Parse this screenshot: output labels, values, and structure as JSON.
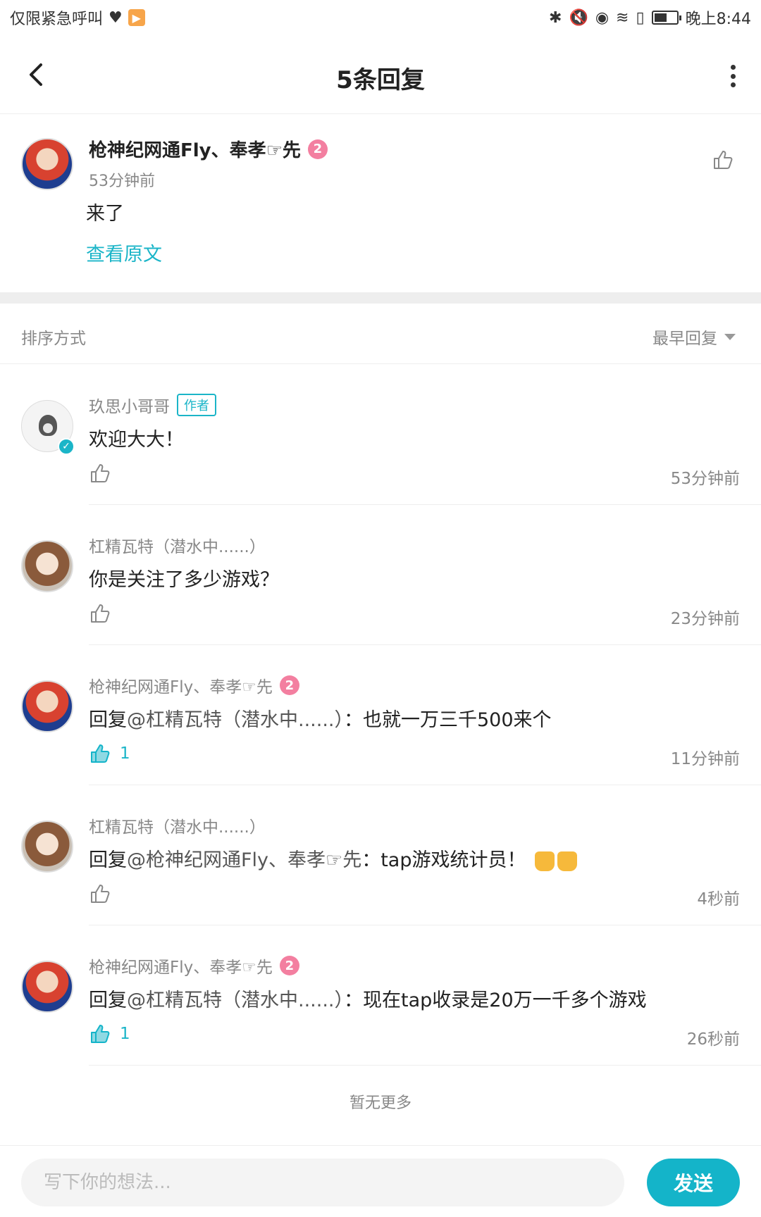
{
  "statusbar": {
    "left_text": "仅限紧急呼叫",
    "time": "晚上8:44",
    "battery_level": 0.55
  },
  "nav": {
    "title": "5条回复"
  },
  "original": {
    "name": "枪神纪网通Fly、奉孝☞先",
    "level": "2",
    "time": "53分钟前",
    "text": "来了",
    "link": "查看原文"
  },
  "sort": {
    "label": "排序方式",
    "value": "最早回复"
  },
  "replies": [
    {
      "name": "玖思小哥哥",
      "tag": "作者",
      "text": "欢迎大大！",
      "time": "53分钟前",
      "likes": ""
    },
    {
      "name": "杠精瓦特（潜水中......）",
      "text": "你是关注了多少游戏？",
      "time": "23分钟前",
      "likes": ""
    },
    {
      "name": "枪神纪网通Fly、奉孝☞先",
      "level": "2",
      "reply_prefix": "回复",
      "mention": "@杠精瓦特（潜水中......）",
      "text": "：也就一万三千500来个",
      "time": "11分钟前",
      "likes": "1"
    },
    {
      "name": "杠精瓦特（潜水中......）",
      "reply_prefix": "回复",
      "mention": "@枪神纪网通Fly、奉孝☞先",
      "text": "：tap游戏统计员！",
      "time": "4秒前",
      "likes": ""
    },
    {
      "name": "枪神纪网通Fly、奉孝☞先",
      "level": "2",
      "reply_prefix": "回复",
      "mention": "@杠精瓦特（潜水中......）",
      "text": "：现在tap收录是20万一千多个游戏",
      "time": "26秒前",
      "likes": "1"
    }
  ],
  "footer": {
    "no_more": "暂无更多"
  },
  "bottom": {
    "placeholder": "写下你的想法...",
    "send_label": "发送"
  },
  "colors": {
    "accent": "#14b4c9",
    "level_badge": "#f37fa0"
  }
}
